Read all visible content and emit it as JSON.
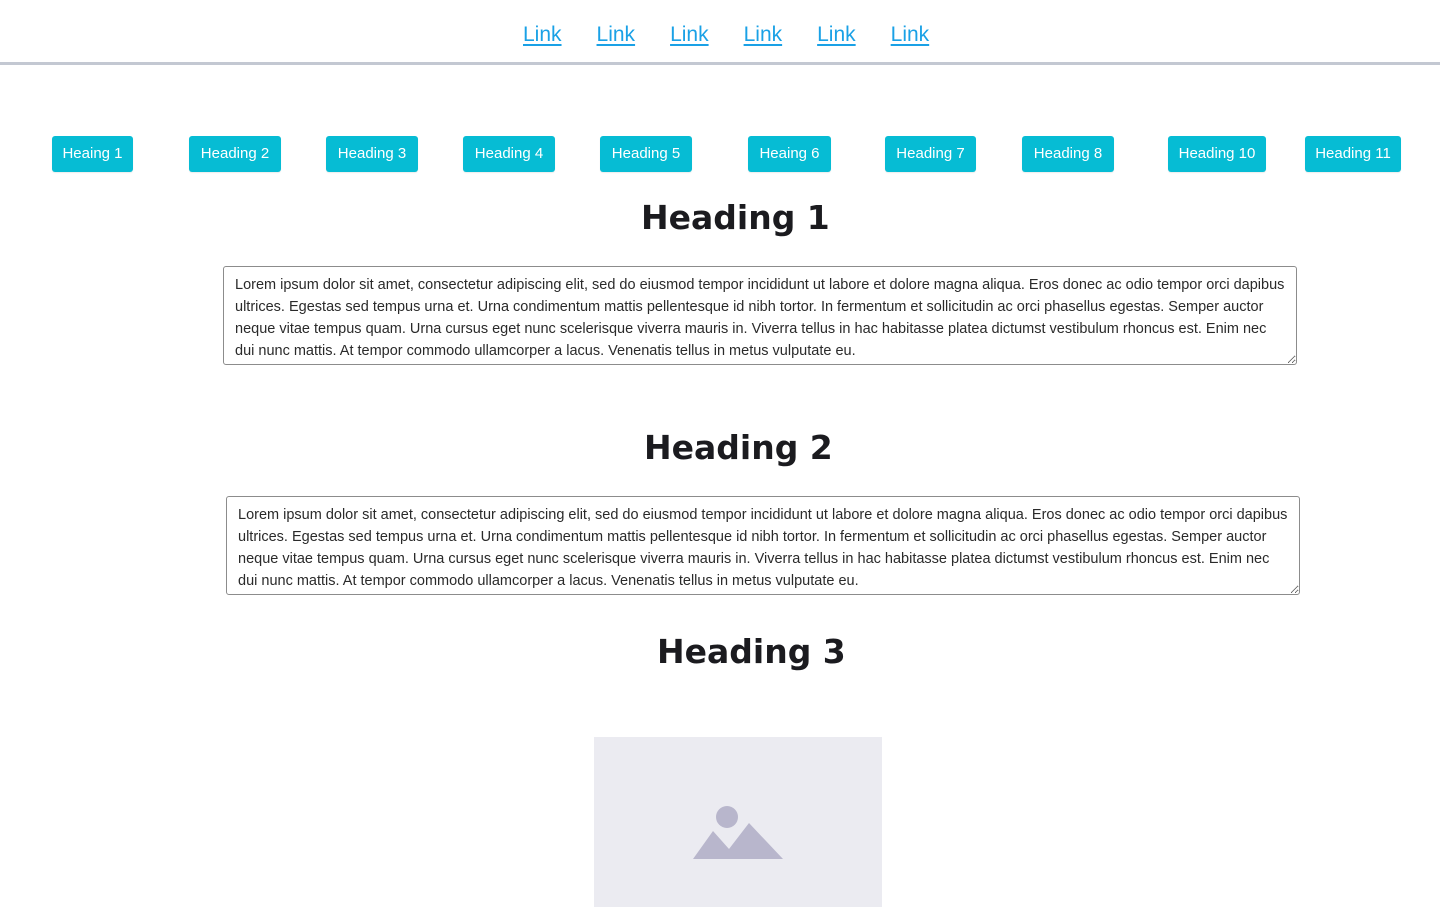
{
  "nav": {
    "links": [
      "Link",
      "Link",
      "Link",
      "Link",
      "Link",
      "Link"
    ]
  },
  "buttons": [
    "Heaing 1",
    "Heading 2",
    "Heading 3",
    "Heading 4",
    "Heading 5",
    "Heaing 6",
    "Heading 7",
    "Heading 8",
    "Heading 10",
    "Heading 11"
  ],
  "sections": [
    {
      "heading": "Heading 1",
      "text": "Lorem ipsum dolor sit amet, consectetur adipiscing elit, sed do eiusmod tempor incididunt ut labore et dolore magna aliqua. Eros donec ac odio tempor orci dapibus ultrices. Egestas sed tempus urna et. Urna condimentum mattis pellentesque id nibh tortor. In fermentum et sollicitudin ac orci phasellus egestas. Semper auctor neque vitae tempus quam. Urna cursus eget nunc scelerisque viverra mauris in. Viverra tellus in hac habitasse platea dictumst vestibulum rhoncus est. Enim nec dui nunc mattis. At tempor commodo ullamcorper a lacus. Venenatis tellus in metus vulputate eu."
    },
    {
      "heading": "Heading 2",
      "text": "Lorem ipsum dolor sit amet, consectetur adipiscing elit, sed do eiusmod tempor incididunt ut labore et dolore magna aliqua. Eros donec ac odio tempor orci dapibus ultrices. Egestas sed tempus urna et. Urna condimentum mattis pellentesque id nibh tortor. In fermentum et sollicitudin ac orci phasellus egestas. Semper auctor neque vitae tempus quam. Urna cursus eget nunc scelerisque viverra mauris in. Viverra tellus in hac habitasse platea dictumst vestibulum rhoncus est. Enim nec dui nunc mattis. At tempor commodo ullamcorper a lacus. Venenatis tellus in metus vulputate eu."
    },
    {
      "heading": "Heading 3",
      "image_icon": "image-placeholder-icon"
    }
  ],
  "colors": {
    "link": "#1aa1e6",
    "button_bg": "#06bcd4",
    "nav_border": "#c3c8d2",
    "image_bg": "#ebebf1",
    "image_icon": "#b8b6cc"
  }
}
